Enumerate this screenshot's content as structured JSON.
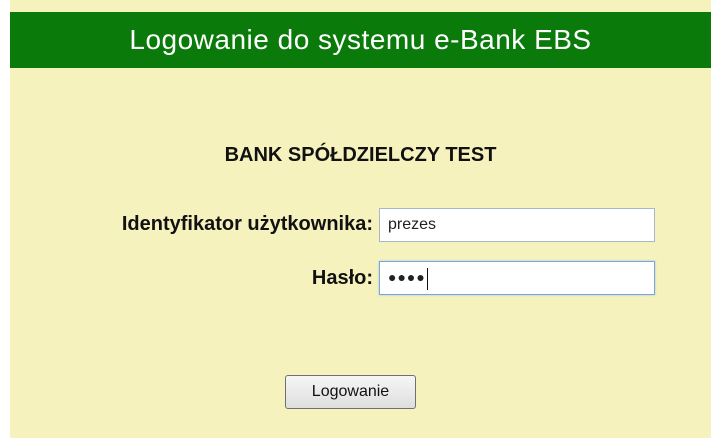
{
  "header": {
    "title": "Logowanie do systemu e-Bank EBS"
  },
  "login": {
    "bank_name": "BANK SPÓŁDZIELCZY TEST",
    "user_label": "Identyfikator użytkownika:",
    "user_value": "prezes",
    "password_label": "Hasło:",
    "password_masked": "●●●●",
    "submit_label": "Logowanie"
  },
  "colors": {
    "header_bg": "#0a7a0a",
    "panel_bg": "#f5f2bd",
    "header_text": "#ffffff"
  }
}
